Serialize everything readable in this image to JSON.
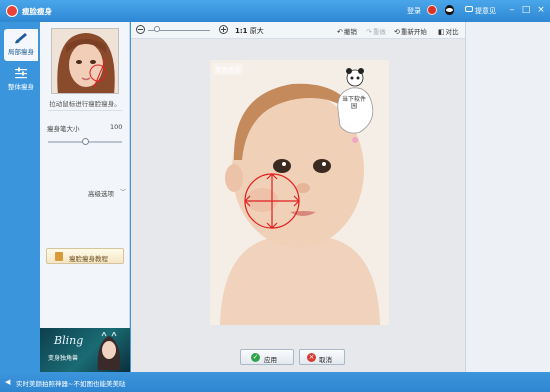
{
  "titlebar": {
    "title": "瘦脸瘦身",
    "login": "登录",
    "feedback": "提意见"
  },
  "tabs": [
    {
      "label": "局部瘦身",
      "icon": "brush-icon",
      "active": true
    },
    {
      "label": "整体瘦身",
      "icon": "sliders-icon",
      "active": false
    }
  ],
  "left_panel": {
    "preview_caption": "拉动鼠标进行瘦脸瘦身。",
    "brush_size_label": "瘦身笔大小",
    "brush_size_value": "100",
    "brush_size_fraction": 0.5,
    "advanced_label": "高级选项",
    "tutorial_label": "瘦脸瘦身教程"
  },
  "ad_banner": {
    "title": "Bling",
    "subtitle": "变身独角兽"
  },
  "toolbar": {
    "zoom_fraction": 0.15,
    "zoom_ratio": "1:1",
    "zoom_original": "原大",
    "undo": "撤销",
    "redo": "重做",
    "restart": "重新开始",
    "compare": "对比"
  },
  "photo": {
    "watermark": "美图秀秀",
    "bubble_text": "当下软件园"
  },
  "actions": {
    "apply": "应用",
    "cancel": "取消"
  },
  "statusbar": {
    "tip": "实时美颜拍照神器~不如图也能美美哒"
  },
  "colors": {
    "titlebar": "#3f97dc",
    "marker": "#e02020",
    "apply_icon": "#2fa34a",
    "cancel_icon": "#d83b32"
  }
}
